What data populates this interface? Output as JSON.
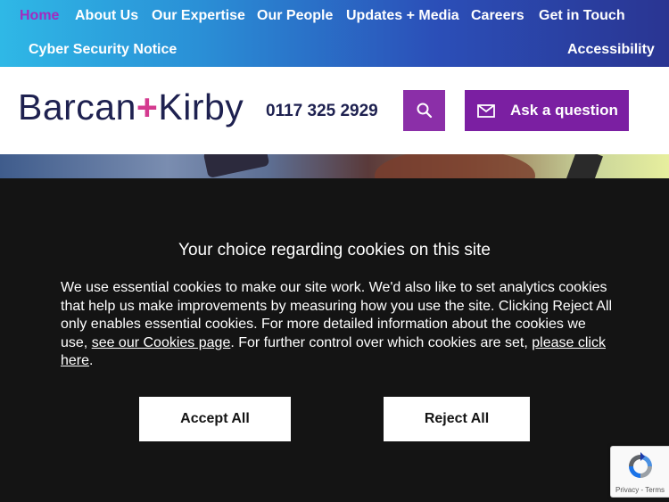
{
  "nav": {
    "items": [
      {
        "label": "Home",
        "active": true
      },
      {
        "label": "About Us"
      },
      {
        "label": "Our Expertise"
      },
      {
        "label": "Our People"
      },
      {
        "label": "Updates + Media"
      },
      {
        "label": "Careers"
      },
      {
        "label": "Get in Touch"
      },
      {
        "label": "Cyber Security Notice"
      },
      {
        "label": "Accessibility"
      }
    ]
  },
  "header": {
    "logo_left": "Barcan",
    "logo_plus": "+",
    "logo_right": "Kirby",
    "phone": "0117 325 2929",
    "search_icon": "search-icon",
    "ask_icon": "envelope-icon",
    "ask_label": "Ask a question"
  },
  "cookie": {
    "title": "Your choice regarding cookies on this site",
    "text_1": "We use essential cookies to make our site work. We'd also like to set analytics cookies that help us make improvements by measuring how you use the site. Clicking Reject All only enables essential cookies. For more detailed information about the cookies we use, ",
    "link_1": "see our Cookies page",
    "text_2": ". For further control over which cookies are set, ",
    "link_2": "please click here",
    "text_3": ".",
    "accept_label": "Accept All",
    "reject_label": "Reject All"
  },
  "recaptcha": {
    "privacy": "Privacy",
    "separator": " - ",
    "terms": "Terms"
  },
  "colors": {
    "accent_purple": "#7b1fa2",
    "active_nav": "#a32bbf",
    "brand_navy": "#1e2150",
    "brand_plus": "#d43a8f",
    "overlay": "#141414"
  }
}
